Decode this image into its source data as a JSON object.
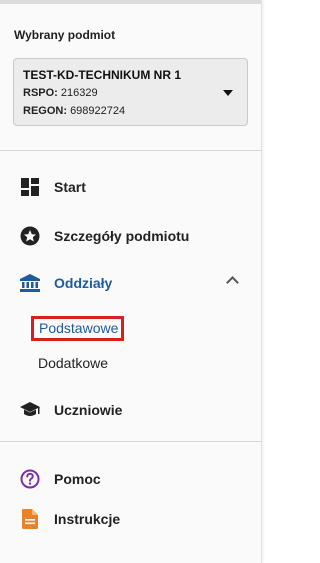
{
  "selected_entity": {
    "section_title": "Wybrany podmiot",
    "name": "TEST-KD-TECHNIKUM NR 1",
    "rspo_label": "RSPO:",
    "rspo_value": "216329",
    "regon_label": "REGON:",
    "regon_value": "698922724"
  },
  "nav": {
    "start": "Start",
    "entity_details": "Szczegóły podmiotu",
    "branches": "Oddziały",
    "branches_sub": [
      "Podstawowe",
      "Dodatkowe"
    ],
    "students": "Uczniowie",
    "help": "Pomoc",
    "instructions": "Instrukcje"
  },
  "colors": {
    "accent": "#1e5b9c",
    "highlight_border": "#d81e1e",
    "help_icon": "#7b2fa8",
    "instructions_icon": "#e8832a"
  }
}
